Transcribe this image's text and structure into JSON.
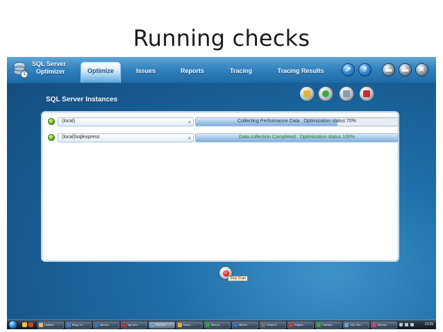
{
  "slide": {
    "title": "Running checks"
  },
  "app": {
    "name_line1": "SQL Server",
    "name_line2": "Optimizer",
    "tabs": [
      {
        "label": "Optimize",
        "active": true
      },
      {
        "label": "Issues"
      },
      {
        "label": "Reports"
      },
      {
        "label": "Tracing"
      },
      {
        "label": "Tracing Results"
      }
    ],
    "header_buttons": [
      {
        "name": "back-icon",
        "glyph": "↗"
      },
      {
        "name": "help-icon",
        "glyph": "?"
      },
      {
        "name": "minimize-icon",
        "glyph": "▬"
      },
      {
        "name": "maximize-icon",
        "glyph": "▬"
      },
      {
        "name": "close-icon",
        "glyph": "✕"
      }
    ]
  },
  "section": {
    "title": "SQL Server Instances",
    "toolbar": [
      {
        "name": "open-folder-icon",
        "color": "#e2b13a"
      },
      {
        "name": "download-icon",
        "color": "#3fa83a"
      },
      {
        "name": "server-icon",
        "color": "#8f9aa5"
      },
      {
        "name": "remove-server-icon",
        "color": "#cc2a2a"
      }
    ]
  },
  "instances": [
    {
      "name": "(local)",
      "status": "Collecting Performance Data : Optimization status 70%",
      "progress": 70,
      "done": false
    },
    {
      "name": "(local)\\sqlexpress",
      "status": "Data collection Completed : Optimization status 100%",
      "progress": 100,
      "done": true
    }
  ],
  "stop_scan": {
    "tooltip": "Stop Scan"
  },
  "taskbar": {
    "items": [
      {
        "label": "Untitled",
        "color": "#e0c060"
      },
      {
        "label": "Blog | S...",
        "color": "#4080d0"
      },
      {
        "label": "Micros...",
        "color": "#3a70c0"
      },
      {
        "label": "sql serv...",
        "color": "#c03030"
      },
      {
        "label": "SQLSer...",
        "color": "#6aa0d0",
        "active": true
      },
      {
        "label": "Inbox -...",
        "color": "#e0b040"
      },
      {
        "label": "Micros...",
        "color": "#30a040"
      },
      {
        "label": "Micros...",
        "color": "#3a70c0"
      },
      {
        "label": "Script S...",
        "color": "#707070"
      },
      {
        "label": "Engine...",
        "color": "#c04040"
      },
      {
        "label": "Camtas...",
        "color": "#40a040"
      },
      {
        "label": "SQL Ser...",
        "color": "#6aa0d0"
      },
      {
        "label": "Micros...",
        "color": "#c04080"
      }
    ],
    "clock": "13:25"
  }
}
